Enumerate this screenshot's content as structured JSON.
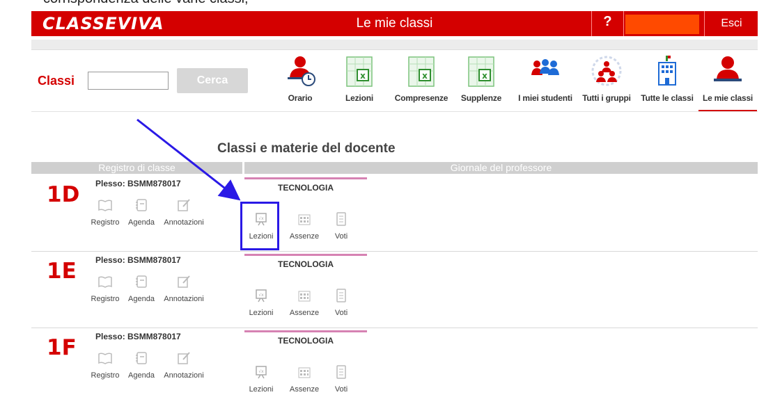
{
  "caption": "corrispondenza delle varie classi;",
  "header": {
    "logo": "CLASSEVIVA",
    "title": "Le mie classi",
    "help": "?",
    "logout": "Esci"
  },
  "search": {
    "label": "Classi",
    "button": "Cerca",
    "value": ""
  },
  "toolbar": [
    {
      "label": "Orario",
      "icon": "schedule-icon"
    },
    {
      "label": "Lezioni",
      "icon": "lessons-sheet-icon"
    },
    {
      "label": "Compresenze",
      "icon": "copresence-sheet-icon"
    },
    {
      "label": "Supplenze",
      "icon": "substitution-sheet-icon"
    },
    {
      "label": "I miei studenti",
      "icon": "students-icon"
    },
    {
      "label": "Tutti i gruppi",
      "icon": "groups-icon"
    },
    {
      "label": "Tutte le classi",
      "icon": "school-icon"
    },
    {
      "label": "Le mie classi",
      "icon": "teacher-icon",
      "active": true
    }
  ],
  "main": {
    "heading": "Classi e materie del docente",
    "col_registro": "Registro di classe",
    "col_giornale": "Giornale del professore"
  },
  "rows": [
    {
      "class": "1D",
      "plesso": "Plesso: BSMM878017",
      "subject": "TECNOLOGIA"
    },
    {
      "class": "1E",
      "plesso": "Plesso: BSMM878017",
      "subject": "TECNOLOGIA"
    },
    {
      "class": "1F",
      "plesso": "Plesso: BSMM878017",
      "subject": "TECNOLOGIA"
    }
  ],
  "row_actions": {
    "registro": "Registro",
    "agenda": "Agenda",
    "annotazioni": "Annotazioni",
    "lezioni": "Lezioni",
    "assenze": "Assenze",
    "voti": "Voti"
  },
  "colors": {
    "brand_red": "#d40000",
    "annotation_blue": "#2a19e6",
    "subject_pink": "#d682b3"
  }
}
